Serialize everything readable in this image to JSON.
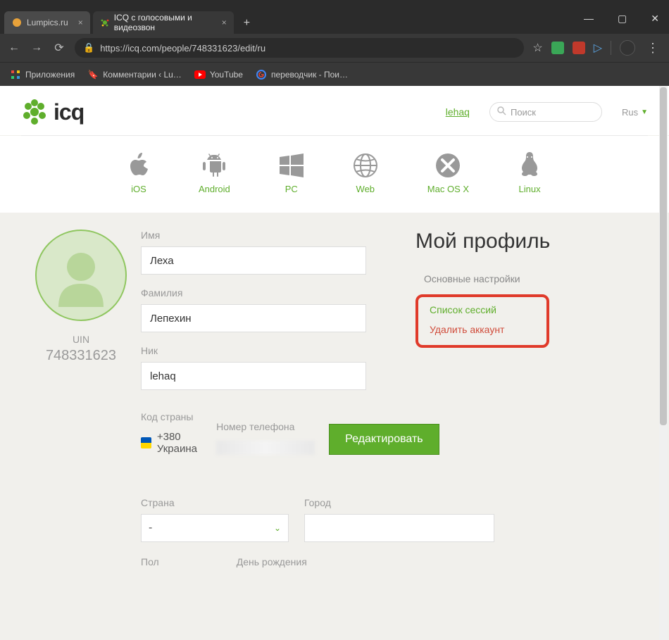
{
  "window": {
    "tabs": [
      {
        "title": "Lumpics.ru",
        "active": false
      },
      {
        "title": "ICQ с голосовыми и видеозвон",
        "active": true
      }
    ]
  },
  "addressBar": {
    "url": "https://icq.com/people/748331623/edit/ru"
  },
  "bookmarks": {
    "apps": "Приложения",
    "items": [
      {
        "label": "Комментарии ‹ Lu…"
      },
      {
        "label": "YouTube"
      },
      {
        "label": "переводчик - Пои…"
      }
    ]
  },
  "header": {
    "logo": "icq",
    "userLink": "lehaq",
    "searchPlaceholder": "Поиск",
    "lang": "Rus"
  },
  "platforms": [
    {
      "label": "iOS"
    },
    {
      "label": "Android"
    },
    {
      "label": "PC"
    },
    {
      "label": "Web"
    },
    {
      "label": "Mac OS X"
    },
    {
      "label": "Linux"
    }
  ],
  "profile": {
    "uinLabel": "UIN",
    "uin": "748331623",
    "labels": {
      "firstName": "Имя",
      "lastName": "Фамилия",
      "nick": "Ник",
      "countryCode": "Код страны",
      "phone": "Номер телефона",
      "edit": "Редактировать",
      "country": "Страна",
      "city": "Город",
      "gender": "Пол",
      "birthday": "День рождения"
    },
    "values": {
      "firstName": "Леха",
      "lastName": "Лепехин",
      "nick": "lehaq",
      "countryCode": "+380 Украина",
      "countrySelect": "-"
    }
  },
  "sidebar": {
    "title": "Мой профиль",
    "subtitle": "Основные настройки",
    "sessionsLink": "Список сессий",
    "deleteLink": "Удалить аккаунт"
  }
}
